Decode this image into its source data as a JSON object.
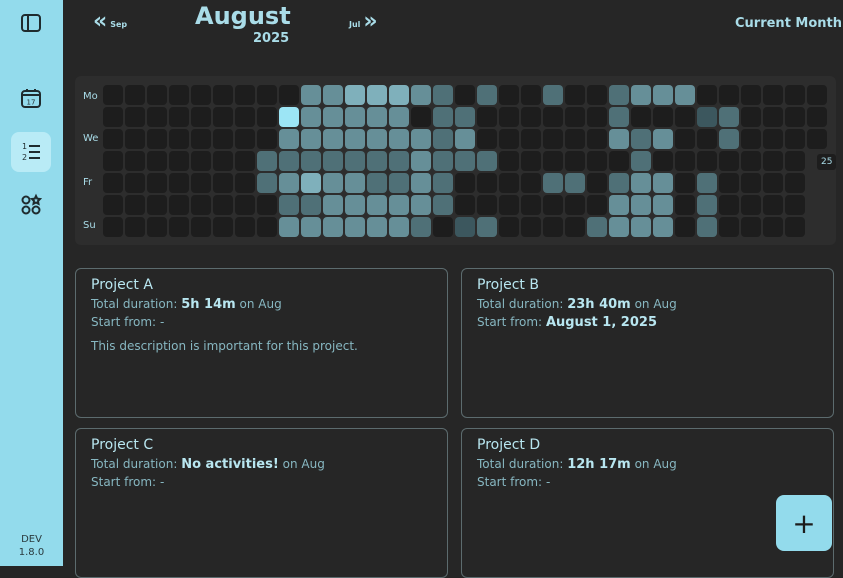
{
  "sidebar": {
    "items": [
      {
        "icon": "sidebar-toggle-icon"
      },
      {
        "icon": "calendar-icon",
        "badge": "17"
      },
      {
        "icon": "list-icon"
      },
      {
        "icon": "apps-icon"
      }
    ],
    "env": "DEV",
    "version": "1.8.0"
  },
  "header": {
    "prev_label": "Sep",
    "next_label": "Jul",
    "month": "August",
    "year": "2025",
    "current_label": "Current Month"
  },
  "heatmap": {
    "day_labels": [
      "Mo",
      "We",
      "Fr",
      "Su"
    ],
    "count_label": "25",
    "rows": [
      [
        0,
        0,
        0,
        0,
        0,
        0,
        0,
        0,
        0,
        3,
        3,
        4,
        4,
        4,
        3,
        2,
        0,
        2,
        0,
        0,
        2,
        0,
        0,
        2,
        3,
        3,
        3,
        0,
        0,
        0,
        0,
        0,
        0
      ],
      [
        0,
        0,
        0,
        0,
        0,
        0,
        0,
        0,
        5,
        3,
        3,
        3,
        3,
        3,
        0,
        2,
        2,
        0,
        0,
        0,
        0,
        0,
        0,
        2,
        0,
        0,
        0,
        1,
        2,
        0,
        0,
        0,
        0
      ],
      [
        0,
        0,
        0,
        0,
        0,
        0,
        0,
        0,
        3,
        3,
        3,
        3,
        3,
        3,
        3,
        2,
        3,
        0,
        0,
        0,
        0,
        0,
        0,
        3,
        2,
        3,
        0,
        0,
        2,
        0,
        0,
        0,
        0
      ],
      [
        0,
        0,
        0,
        0,
        0,
        0,
        0,
        2,
        2,
        2,
        2,
        2,
        2,
        2,
        3,
        2,
        2,
        2,
        0,
        0,
        0,
        0,
        0,
        0,
        2,
        0,
        0,
        0,
        0,
        0,
        0,
        0,
        0
      ],
      [
        0,
        0,
        0,
        0,
        0,
        0,
        0,
        2,
        3,
        4,
        3,
        3,
        2,
        2,
        3,
        2,
        0,
        0,
        0,
        0,
        2,
        2,
        0,
        2,
        3,
        3,
        0,
        2,
        0,
        0,
        0,
        0,
        0
      ],
      [
        0,
        0,
        0,
        0,
        0,
        0,
        0,
        0,
        2,
        2,
        3,
        3,
        3,
        3,
        3,
        2,
        0,
        0,
        0,
        0,
        0,
        0,
        0,
        3,
        3,
        3,
        0,
        2,
        0,
        0,
        0,
        0,
        0
      ],
      [
        0,
        0,
        0,
        0,
        0,
        0,
        0,
        0,
        3,
        3,
        3,
        3,
        3,
        3,
        2,
        0,
        1,
        2,
        0,
        0,
        0,
        0,
        2,
        3,
        3,
        3,
        0,
        2,
        0,
        0,
        0,
        0,
        0
      ]
    ]
  },
  "projects": [
    {
      "name": "Project A",
      "duration_label": "Total duration:",
      "duration": "5h 14m",
      "on_label": "on Aug",
      "start_label": "Start from:",
      "start": "-",
      "description": "This description is important for this project."
    },
    {
      "name": "Project B",
      "duration_label": "Total duration:",
      "duration": "23h 40m",
      "on_label": "on Aug",
      "start_label": "Start from:",
      "start": "August 1, 2025",
      "description": ""
    },
    {
      "name": "Project C",
      "duration_label": "Total duration:",
      "duration": "No activities!",
      "on_label": "on Aug",
      "start_label": "Start from:",
      "start": "-",
      "description": ""
    },
    {
      "name": "Project D",
      "duration_label": "Total duration:",
      "duration": "12h 17m",
      "on_label": "on Aug",
      "start_label": "Start from:",
      "start": "-",
      "description": ""
    }
  ],
  "fab_label": "+"
}
